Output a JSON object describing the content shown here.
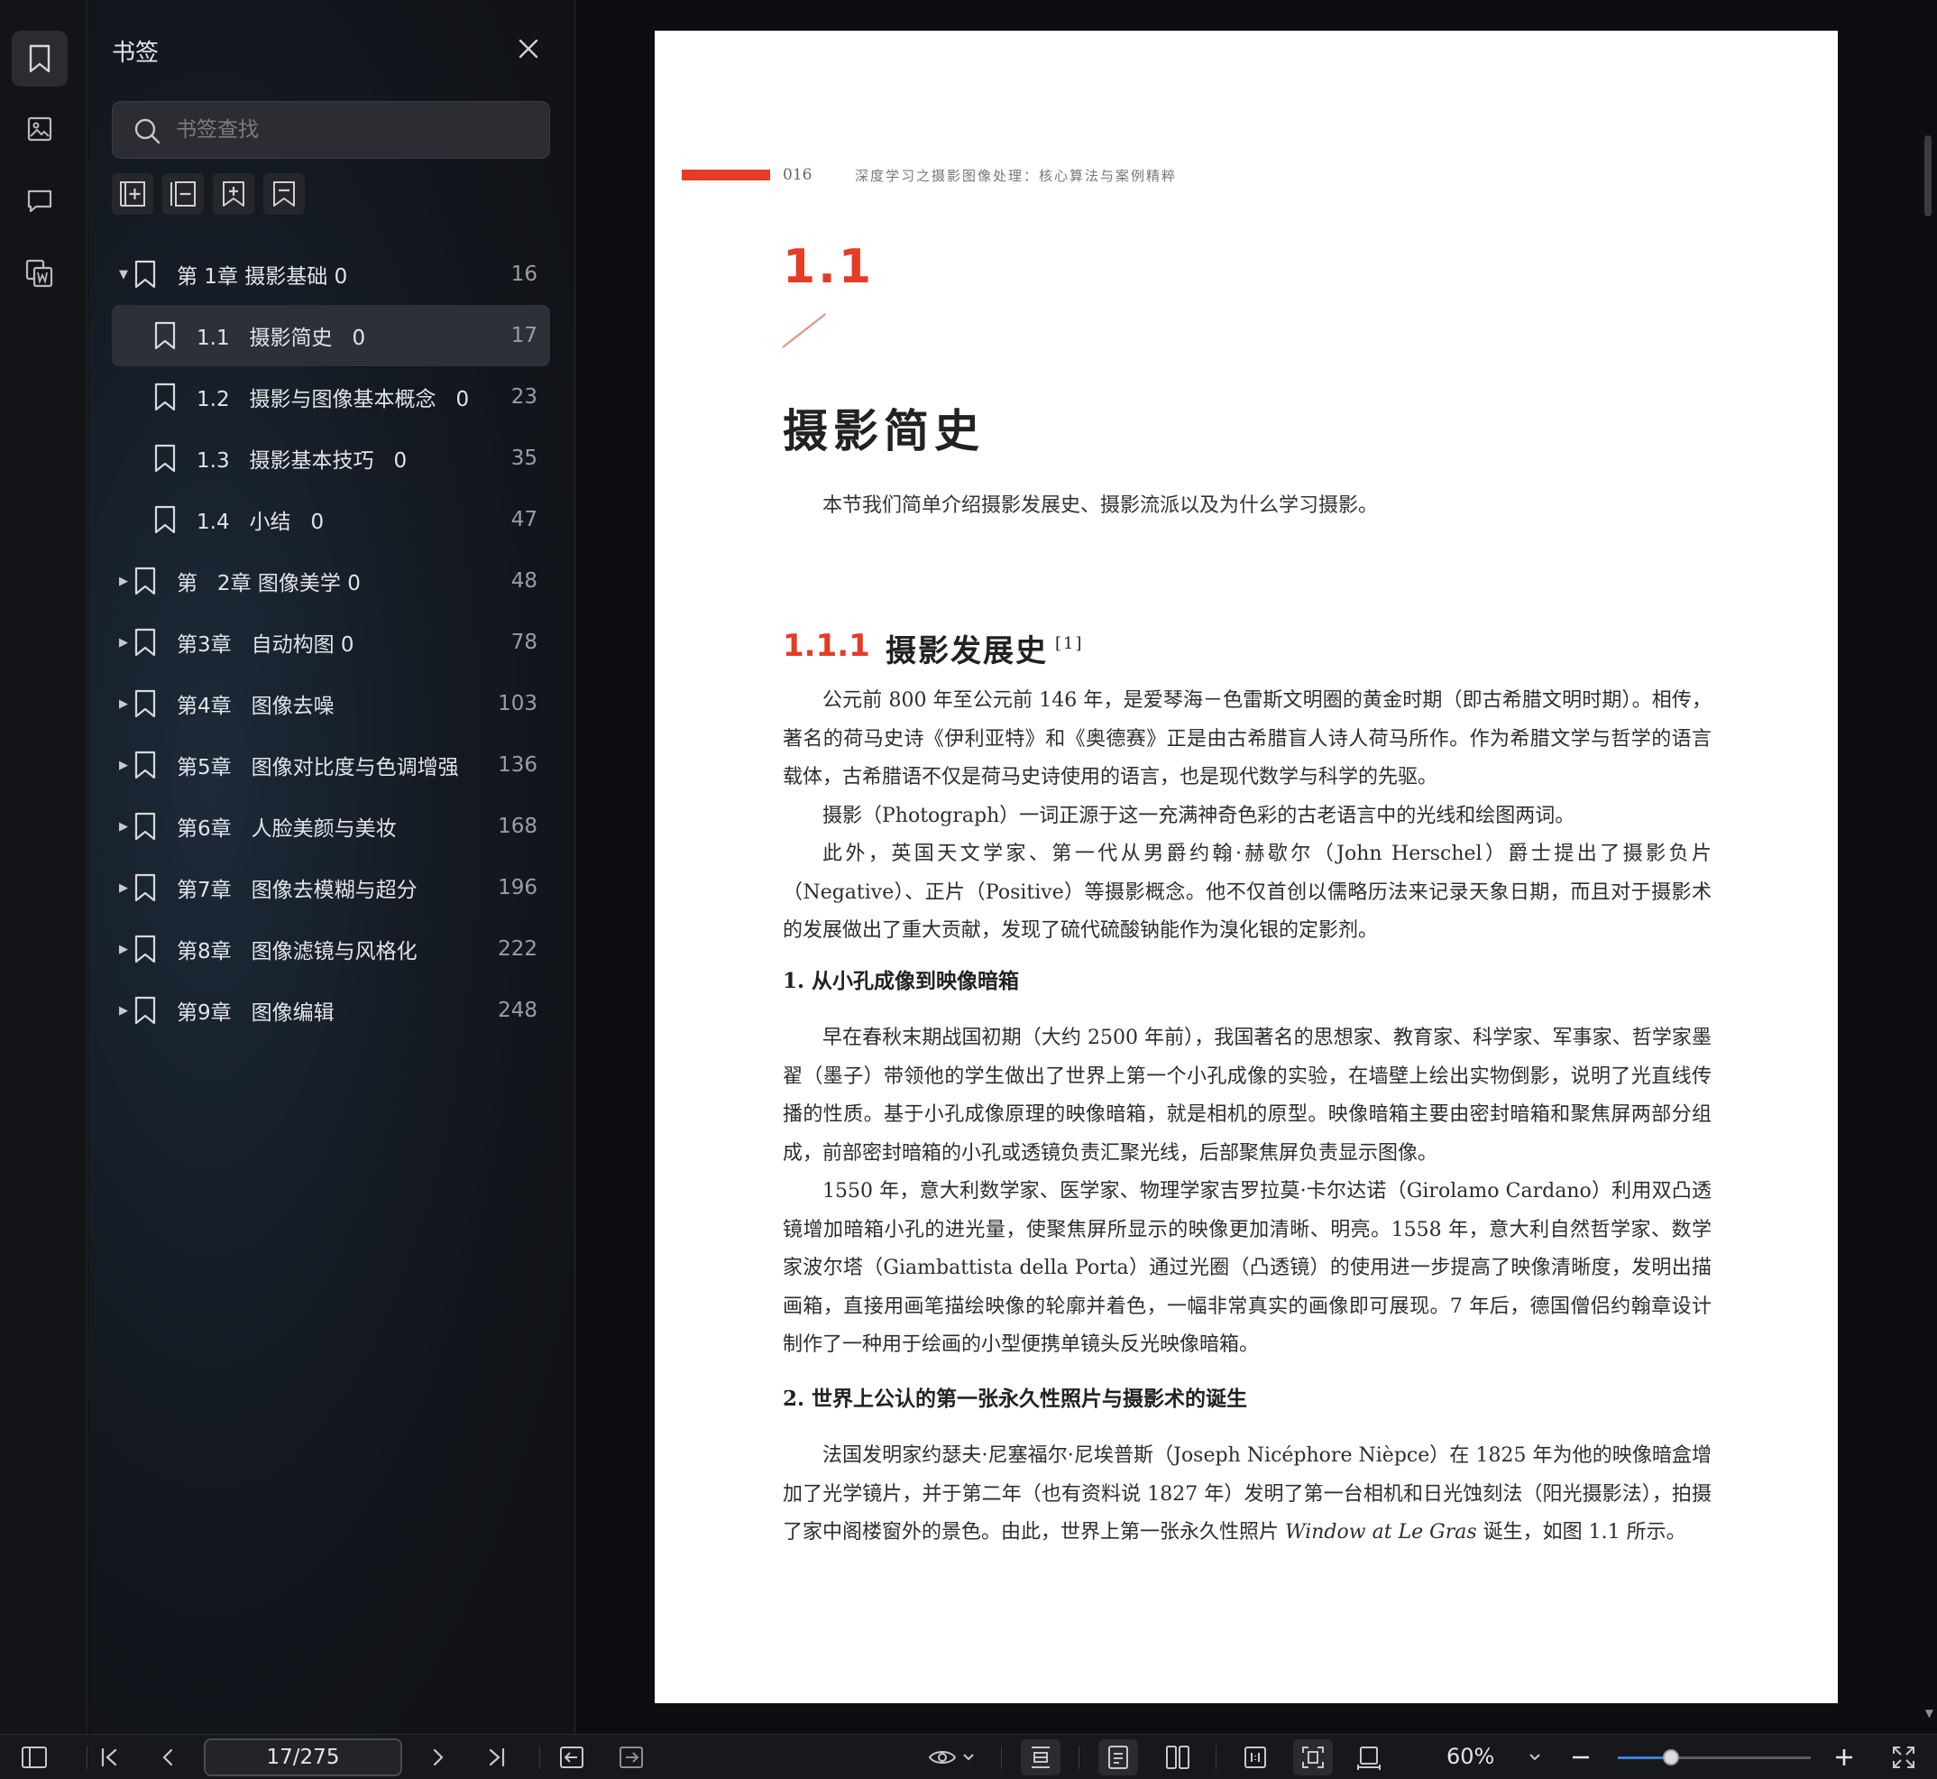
{
  "sidebar": {
    "title": "书签",
    "search_placeholder": "书签查找",
    "items": [
      {
        "level": 1,
        "expanded": true,
        "label": "第 1章 摄影基础 0",
        "page": "16"
      },
      {
        "level": 2,
        "selected": true,
        "label": "1.1   摄影简史   0",
        "page": "17"
      },
      {
        "level": 2,
        "label": "1.2   摄影与图像基本概念   0",
        "page": "23"
      },
      {
        "level": 2,
        "label": "1.3   摄影基本技巧   0",
        "page": "35"
      },
      {
        "level": 2,
        "label": "1.4   小结   0",
        "page": "47"
      },
      {
        "level": 1,
        "label": "第   2章 图像美学 0",
        "page": "48"
      },
      {
        "level": 1,
        "label": "第3章   自动构图 0",
        "page": "78"
      },
      {
        "level": 1,
        "label": "第4章   图像去噪",
        "page": "103"
      },
      {
        "level": 1,
        "label": "第5章   图像对比度与色调增强",
        "page": "136"
      },
      {
        "level": 1,
        "label": "第6章   人脸美颜与美妆",
        "page": "168"
      },
      {
        "level": 1,
        "label": "第7章   图像去模糊与超分",
        "page": "196"
      },
      {
        "level": 1,
        "label": "第8章   图像滤镜与风格化",
        "page": "222"
      },
      {
        "level": 1,
        "label": "第9章   图像编辑",
        "page": "248"
      }
    ]
  },
  "page": {
    "header_number": "016",
    "header_title": "深度学习之摄影图像处理：核心算法与案例精粹",
    "section_number": "1.1",
    "section_title": "摄影简史",
    "intro": "本节我们简单介绍摄影发展史、摄影流派以及为什么学习摄影。",
    "subsection_number": "1.1.1",
    "subsection_title": "摄影发展史",
    "subsection_ref": "[1]",
    "block1": [
      "公元前 800 年至公元前 146 年，是爱琴海－色雷斯文明圈的黄金时期（即古希腊文明时期）。相传，著名的荷马史诗《伊利亚特》和《奥德赛》正是由古希腊盲人诗人荷马所作。作为希腊文学与哲学的语言载体，古希腊语不仅是荷马史诗使用的语言，也是现代数学与科学的先驱。",
      "摄影（Photograph）一词正源于这一充满神奇色彩的古老语言中的光线和绘图两词。",
      "此外，英国天文学家、第一代从男爵约翰·赫歇尔（John Herschel）爵士提出了摄影负片（Negative）、正片（Positive）等摄影概念。他不仅首创以儒略历法来记录天象日期，而且对于摄影术的发展做出了重大贡献，发现了硫代硫酸钠能作为溴化银的定影剂。"
    ],
    "heading1": "1. 从小孔成像到映像暗箱",
    "block2": [
      "早在春秋末期战国初期（大约 2500 年前），我国著名的思想家、教育家、科学家、军事家、哲学家墨翟（墨子）带领他的学生做出了世界上第一个小孔成像的实验，在墙壁上绘出实物倒影，说明了光直线传播的性质。基于小孔成像原理的映像暗箱，就是相机的原型。映像暗箱主要由密封暗箱和聚焦屏两部分组成，前部密封暗箱的小孔或透镜负责汇聚光线，后部聚焦屏负责显示图像。",
      "1550 年，意大利数学家、医学家、物理学家吉罗拉莫·卡尔达诺（Girolamo Cardano）利用双凸透镜增加暗箱小孔的进光量，使聚焦屏所显示的映像更加清晰、明亮。1558 年，意大利自然哲学家、数学家波尔塔（Giambattista della Porta）通过光圈（凸透镜）的使用进一步提高了映像清晰度，发明出描画箱，直接用画笔描绘映像的轮廓并着色，一幅非常真实的画像即可展现。7 年后，德国僧侣约翰章设计制作了一种用于绘画的小型便携单镜头反光映像暗箱。"
    ],
    "heading2": "2. 世界上公认的第一张永久性照片与摄影术的诞生",
    "block3_pre": "法国发明家约瑟夫·尼塞福尔·尼埃普斯（Joseph Nicéphore Nièpce）在 1825 年为他的映像暗盒增加了光学镜片，并于第二年（也有资料说 1827 年）发明了第一台相机和日光蚀刻法（阳光摄影法），拍摄了家中阁楼窗外的景色。由此，世界上第一张永久性照片 ",
    "block3_italic": "Window at Le Gras",
    "block3_post": " 诞生，如图 1.1 所示。"
  },
  "toolbar": {
    "page_indicator": "17/275",
    "zoom_label": "60%",
    "zoom_level": 0.6
  },
  "colors": {
    "accent_red": "#e63b25",
    "slider_blue": "#3d7fe6"
  }
}
